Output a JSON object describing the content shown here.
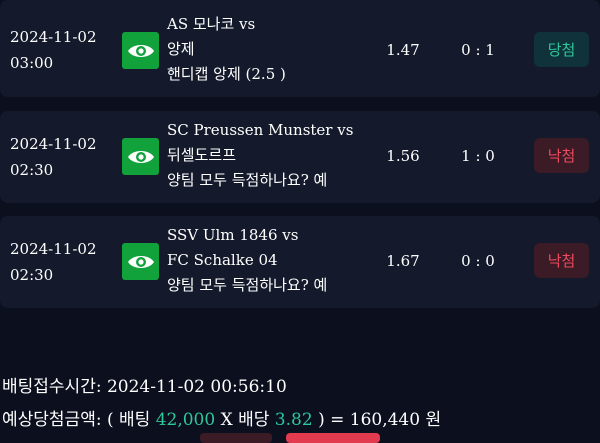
{
  "bets": [
    {
      "date": "2024-11-02",
      "time": "03:00",
      "match_line1": "AS 모나코 vs",
      "match_line2": "앙제",
      "market": "핸디캡 앙제 (2.5 )",
      "odds": "1.47",
      "score": "0 : 1",
      "result": "당첨",
      "result_type": "win"
    },
    {
      "date": "2024-11-02",
      "time": "02:30",
      "match_line1": "SC Preussen Munster vs",
      "match_line2": "뒤셀도르프",
      "market": "양팀 모두 득점하나요? 예",
      "odds": "1.56",
      "score": "1 : 0",
      "result": "낙첨",
      "result_type": "lose"
    },
    {
      "date": "2024-11-02",
      "time": "02:30",
      "match_line1": "SSV Ulm 1846 vs",
      "match_line2": "FC Schalke 04",
      "market": "양팀 모두 득점하나요? 예",
      "odds": "1.67",
      "score": "0 : 0",
      "result": "낙첨",
      "result_type": "lose"
    }
  ],
  "footer": {
    "bet_time_label": "배팅접수시간:",
    "bet_time_value": "2024-11-02 00:56:10",
    "payout_prefix": "예상당첨금액: ( 배팅",
    "stake": "42,000",
    "x_label": "X 배당",
    "total_odds": "3.82",
    "equals": ") = 160,440 원"
  },
  "icons": {
    "view": "eye-icon"
  },
  "colors": {
    "background": "#0b0f1e",
    "card": "#141a2b",
    "eye_button": "#12a23c",
    "win_text": "#2ec79b",
    "lose_text": "#ef4a5f"
  }
}
